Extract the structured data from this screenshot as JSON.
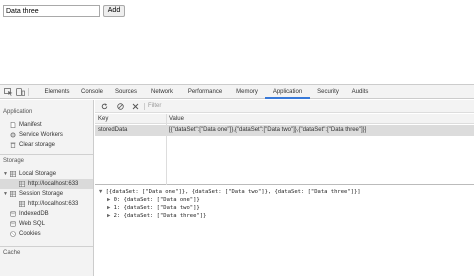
{
  "page": {
    "input_value": "Data three",
    "add_label": "Add"
  },
  "devtools": {
    "tabs": [
      "Elements",
      "Console",
      "Sources",
      "Network",
      "Performance",
      "Memory",
      "Application",
      "Security",
      "Audits"
    ],
    "active_tab": "Application",
    "accent_color": "#3879d9",
    "sidebar": {
      "application_heading": "Application",
      "application_items": [
        "Manifest",
        "Service Workers",
        "Clear storage"
      ],
      "storage_heading": "Storage",
      "local_storage": "Local Storage",
      "local_storage_origin": "http://localhost:633",
      "session_storage": "Session Storage",
      "session_storage_origin": "http://localhost:633",
      "indexeddb": "IndexedDB",
      "websql": "Web SQL",
      "cookies": "Cookies",
      "cache_heading": "Cache"
    },
    "toolbar": {
      "filter_placeholder": "Filter",
      "icons": [
        "refresh-icon",
        "clear-icon",
        "delete-icon"
      ]
    },
    "table": {
      "columns": [
        "Key",
        "Value"
      ],
      "rows": [
        {
          "key": "storedData",
          "value": "[{\"dataSet\":[\"Data one\"]},{\"dataSet\":[\"Data two\"]},{\"dataSet\":[\"Data three\"]}]"
        }
      ]
    },
    "preview": {
      "root": "[{dataSet: [\"Data one\"]}, {dataSet: [\"Data two\"]}, {dataSet: [\"Data three\"]}]",
      "items": [
        "0: {dataSet: [\"Data one\"]}",
        "1: {dataSet: [\"Data two\"]}",
        "2: {dataSet: [\"Data three\"]}"
      ]
    }
  }
}
